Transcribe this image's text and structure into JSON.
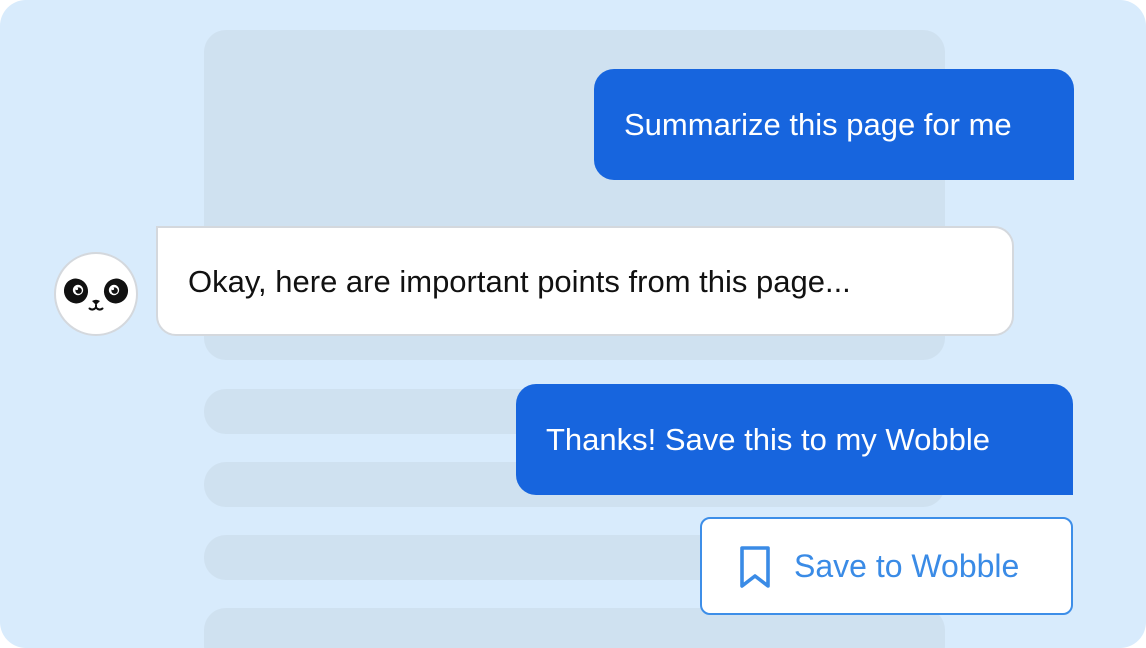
{
  "chat": {
    "messages": [
      {
        "role": "user",
        "text": "Summarize this page for me"
      },
      {
        "role": "assistant",
        "text": "Okay, here are important points from this page..."
      },
      {
        "role": "user",
        "text": "Thanks! Save this to my Wobble"
      }
    ],
    "avatar_icon": "panda-face-icon"
  },
  "action": {
    "save_label": "Save to Wobble",
    "save_icon": "bookmark-icon"
  },
  "colors": {
    "background": "#d8ebfc",
    "skeleton": "#cfe1f0",
    "user_bubble": "#1765de",
    "accent": "#3a8be6"
  }
}
